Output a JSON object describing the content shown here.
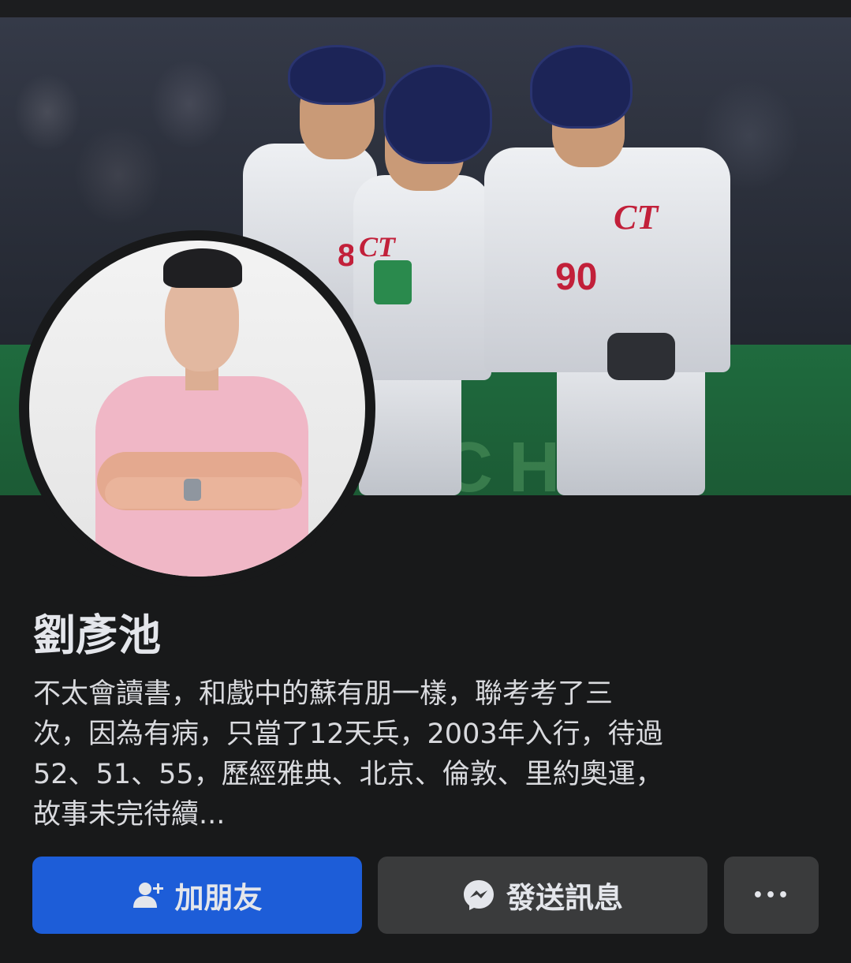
{
  "profile": {
    "name": "劉彥池",
    "bio_lines": [
      "不太會讀書，和戲中的蘇有朋一樣，聯考考了三",
      "次，因為有病，只當了12天兵，2003年入行，待過",
      "52、51、55，歷經雅典、北京、倫敦、里約奧運，",
      "故事未完待續..."
    ]
  },
  "cover": {
    "wall_text": "CH   G",
    "jersey_numbers": [
      "8",
      "90"
    ],
    "logo_text": "CT"
  },
  "actions": {
    "add_friend_label": "加朋友",
    "message_label": "發送訊息",
    "more_label": "•••"
  },
  "colors": {
    "primary": "#1d5dd8",
    "secondary_button": "#3a3b3c",
    "background": "#18191a"
  },
  "icons": {
    "add_friend": "add-person-icon",
    "message": "messenger-icon",
    "more": "more-dots-icon"
  }
}
